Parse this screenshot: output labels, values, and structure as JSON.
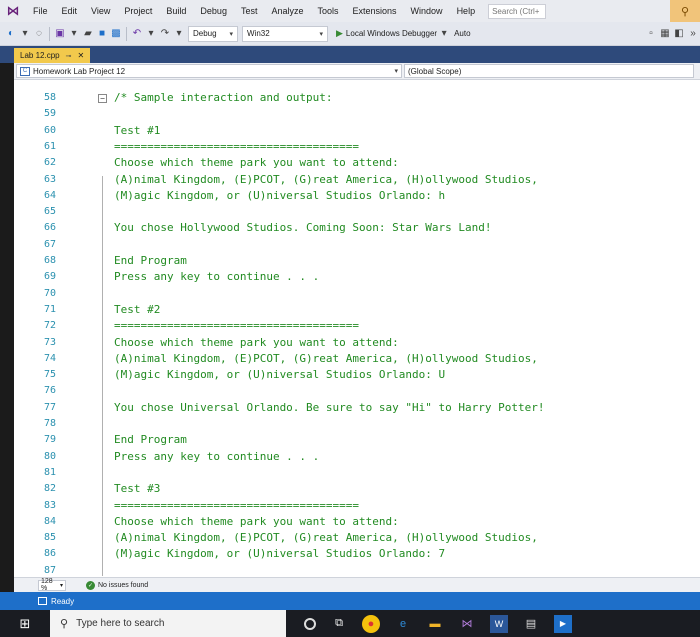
{
  "menu": {
    "items": [
      "File",
      "Edit",
      "View",
      "Project",
      "Build",
      "Debug",
      "Test",
      "Analyze",
      "Tools",
      "Extensions",
      "Window",
      "Help"
    ],
    "search_placeholder": "Search (Ctrl+"
  },
  "toolbar": {
    "config": "Debug",
    "platform": "Win32",
    "debugger": "Local Windows Debugger",
    "mode": "Auto"
  },
  "tab": {
    "label": "Lab 12.cpp"
  },
  "navbar": {
    "project": "Homework Lab Project 12",
    "scope": "(Global Scope)"
  },
  "editor": {
    "lines": [
      {
        "n": "58",
        "t": "/* Sample interaction and output:"
      },
      {
        "n": "59",
        "t": ""
      },
      {
        "n": "60",
        "t": "Test #1"
      },
      {
        "n": "61",
        "t": "====================================="
      },
      {
        "n": "62",
        "t": "Choose which theme park you want to attend:"
      },
      {
        "n": "63",
        "t": "(A)nimal Kingdom, (E)PCOT, (G)reat America, (H)ollywood Studios,"
      },
      {
        "n": "64",
        "t": "(M)agic Kingdom, or (U)niversal Studios Orlando: h"
      },
      {
        "n": "65",
        "t": ""
      },
      {
        "n": "66",
        "t": "You chose Hollywood Studios. Coming Soon: Star Wars Land!"
      },
      {
        "n": "67",
        "t": ""
      },
      {
        "n": "68",
        "t": "End Program"
      },
      {
        "n": "69",
        "t": "Press any key to continue . . ."
      },
      {
        "n": "70",
        "t": ""
      },
      {
        "n": "71",
        "t": "Test #2"
      },
      {
        "n": "72",
        "t": "====================================="
      },
      {
        "n": "73",
        "t": "Choose which theme park you want to attend:"
      },
      {
        "n": "74",
        "t": "(A)nimal Kingdom, (E)PCOT, (G)reat America, (H)ollywood Studios,"
      },
      {
        "n": "75",
        "t": "(M)agic Kingdom, or (U)niversal Studios Orlando: U"
      },
      {
        "n": "76",
        "t": ""
      },
      {
        "n": "77",
        "t": "You chose Universal Orlando. Be sure to say \"Hi\" to Harry Potter!"
      },
      {
        "n": "78",
        "t": ""
      },
      {
        "n": "79",
        "t": "End Program"
      },
      {
        "n": "80",
        "t": "Press any key to continue . . ."
      },
      {
        "n": "81",
        "t": ""
      },
      {
        "n": "82",
        "t": "Test #3"
      },
      {
        "n": "83",
        "t": "====================================="
      },
      {
        "n": "84",
        "t": "Choose which theme park you want to attend:"
      },
      {
        "n": "85",
        "t": "(A)nimal Kingdom, (E)PCOT, (G)reat America, (H)ollywood Studios,"
      },
      {
        "n": "86",
        "t": "(M)agic Kingdom, or (U)niversal Studios Orlando: 7"
      },
      {
        "n": "87",
        "t": ""
      }
    ]
  },
  "editor_status": {
    "zoom": "128 %",
    "issues": "No issues found"
  },
  "statusbar": {
    "text": "Ready"
  },
  "taskbar": {
    "search_placeholder": "Type here to search"
  }
}
